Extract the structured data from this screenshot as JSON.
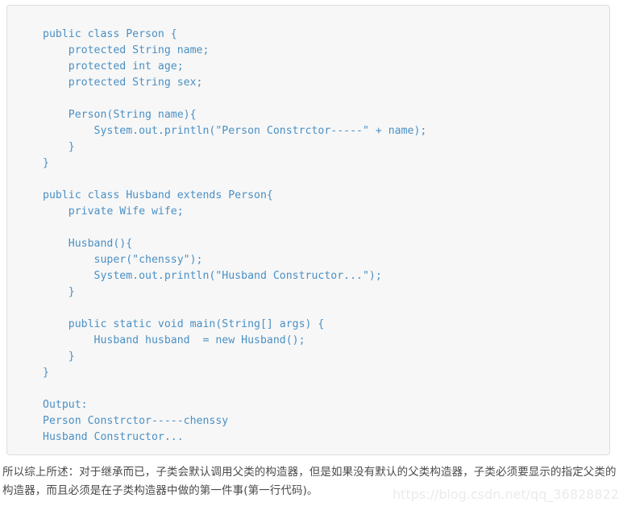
{
  "code_panel": {
    "language": "java",
    "background_color": "#f7f7f7",
    "border_color": "#dddddd",
    "text_color": "#4a90c4",
    "code": "public class Person {\n    protected String name;\n    protected int age;\n    protected String sex;\n\n    Person(String name){\n        System.out.println(\"Person Constrctor-----\" + name);\n    }\n}\n\npublic class Husband extends Person{\n    private Wife wife;\n\n    Husband(){\n        super(\"chenssy\");\n        System.out.println(\"Husband Constructor...\");\n    }\n\n    public static void main(String[] args) {\n        Husband husband  = new Husband();\n    }\n}\n\nOutput:\nPerson Constrctor-----chenssy\nHusband Constructor..."
  },
  "body_text": {
    "paragraph": "所以综上所述：对于继承而已，子类会默认调用父类的构造器，但是如果没有默认的父类构造器，子类必须要显示的指定父类的构造器，而且必须是在子类构造器中做的第一件事(第一行代码)。",
    "text_color": "#4a4a4a"
  },
  "watermark": {
    "text": "https://blog.csdn.net/qq_36828822",
    "color": "#ebebeb"
  }
}
